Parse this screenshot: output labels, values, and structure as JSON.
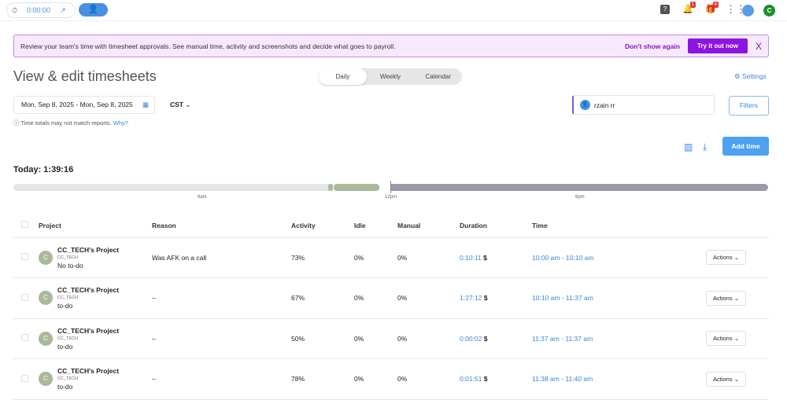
{
  "topbar": {
    "timer": "0:00:00",
    "notifications_count": "1",
    "gifts_count": "4",
    "user_initial": "C"
  },
  "banner": {
    "message": "Review your team's time with timesheet approvals. See manual time, activity and screenshots and decide what goes to payroll.",
    "dont_show": "Don't show again",
    "try": "Try it out now",
    "close": "X"
  },
  "page": {
    "title": "View & edit timesheets",
    "tabs": [
      "Daily",
      "Weekly",
      "Calendar"
    ],
    "active_tab": "Daily",
    "settings": "Settings"
  },
  "filters": {
    "date_range": "Mon, Sep 8, 2025 - Mon, Sep 8, 2025",
    "timezone": "CST",
    "note": "Time totals may not match reports.",
    "why": "Why?",
    "user": "rzain rr",
    "filters_label": "Filters",
    "add_time": "Add time"
  },
  "today": "Today: 1:39:16",
  "timeline": {
    "labels": [
      "6am",
      "12pm",
      "6pm"
    ]
  },
  "table": {
    "headers": [
      "Project",
      "Reason",
      "Activity",
      "Idle",
      "Manual",
      "Duration",
      "Time"
    ],
    "rows": [
      {
        "avatar": "C",
        "project": "CC_TECH's Project",
        "client": "CC_TECH",
        "todo": "No to-do",
        "reason": "Was AFK on a call",
        "activity": "73%",
        "idle": "0%",
        "manual": "0%",
        "duration": "0:10:11",
        "currency": "$",
        "time": "10:00 am - 10:10 am",
        "actions": "Actions"
      },
      {
        "avatar": "C",
        "project": "CC_TECH's Project",
        "client": "CC_TECH",
        "todo": "to-do",
        "reason": "–",
        "activity": "67%",
        "idle": "0%",
        "manual": "0%",
        "duration": "1:27:12",
        "currency": "$",
        "time": "10:10 am - 11:37 am",
        "actions": "Actions"
      },
      {
        "avatar": "C",
        "project": "CC_TECH's Project",
        "client": "CC_TECH",
        "todo": "to-do",
        "reason": "–",
        "activity": "50%",
        "idle": "0%",
        "manual": "0%",
        "duration": "0:00:02",
        "currency": "$",
        "time": "11:37 am - 11:37 am",
        "actions": "Actions"
      },
      {
        "avatar": "C",
        "project": "CC_TECH's Project",
        "client": "CC_TECH",
        "todo": "to-do",
        "reason": "–",
        "activity": "78%",
        "idle": "0%",
        "manual": "0%",
        "duration": "0:01:51",
        "currency": "$",
        "time": "11:38 am - 11:40 am",
        "actions": "Actions"
      }
    ]
  }
}
